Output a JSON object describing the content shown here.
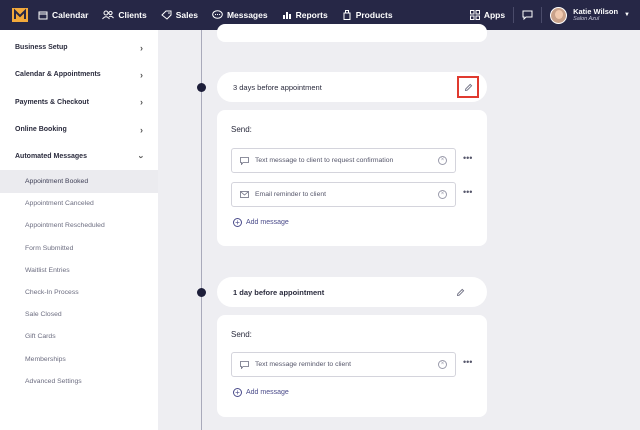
{
  "nav": {
    "items": [
      {
        "label": "Calendar",
        "icon": "calendar-icon"
      },
      {
        "label": "Clients",
        "icon": "clients-icon"
      },
      {
        "label": "Sales",
        "icon": "sales-tag-icon"
      },
      {
        "label": "Messages",
        "icon": "messages-icon"
      },
      {
        "label": "Reports",
        "icon": "reports-icon"
      },
      {
        "label": "Products",
        "icon": "products-icon"
      }
    ],
    "apps_label": "Apps",
    "user": {
      "name": "Katie Wilson",
      "salon": "Salon Azul"
    }
  },
  "sidebar": {
    "sections": [
      {
        "label": "Business Setup"
      },
      {
        "label": "Calendar & Appointments"
      },
      {
        "label": "Payments & Checkout"
      },
      {
        "label": "Online Booking"
      },
      {
        "label": "Automated Messages"
      }
    ],
    "sub_items": [
      {
        "label": "Appointment Booked"
      },
      {
        "label": "Appointment Canceled"
      },
      {
        "label": "Appointment Rescheduled"
      },
      {
        "label": "Form Submitted"
      },
      {
        "label": "Waitlist Entries"
      },
      {
        "label": "Check-In Process"
      },
      {
        "label": "Sale Closed"
      },
      {
        "label": "Gift Cards"
      },
      {
        "label": "Memberships"
      },
      {
        "label": "Advanced Settings"
      }
    ]
  },
  "timeline": {
    "steps": [
      {
        "title": "3 days before appointment",
        "send_label": "Send:",
        "messages": [
          {
            "label": "Text message to client to request confirmation",
            "icon": "sms-icon"
          },
          {
            "label": "Email reminder to client",
            "icon": "email-icon"
          }
        ],
        "add_label": "Add message"
      },
      {
        "title": "1 day before appointment",
        "send_label": "Send:",
        "messages": [
          {
            "label": "Text message reminder to client",
            "icon": "sms-icon"
          }
        ],
        "add_label": "Add message"
      }
    ]
  },
  "colors": {
    "nav_bg": "#262746",
    "highlight": "#e03a2f",
    "accent": "#4a4b8a"
  }
}
